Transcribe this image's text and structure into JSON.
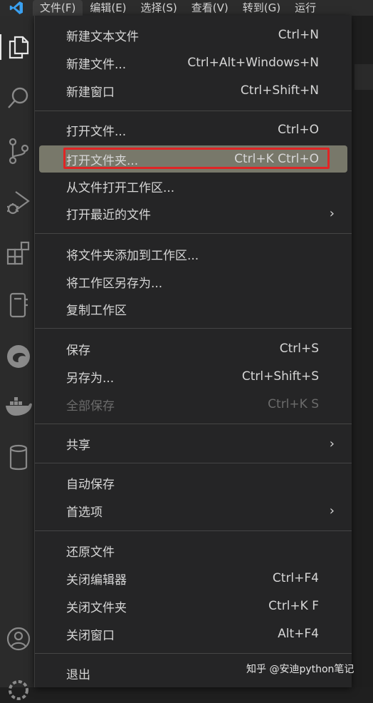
{
  "menubar": {
    "items": [
      "文件(F)",
      "编辑(E)",
      "选择(S)",
      "查看(V)",
      "转到(G)",
      "运行"
    ]
  },
  "activity_icons": [
    "explorer-icon",
    "search-icon",
    "source-control-icon",
    "run-debug-icon",
    "extensions-icon",
    "notebook-icon",
    "edge-icon",
    "docker-icon",
    "database-icon",
    "account-icon",
    "settings-icon"
  ],
  "file_menu": {
    "items": [
      {
        "label": "新建文本文件",
        "shortcut": "Ctrl+N"
      },
      {
        "label": "新建文件...",
        "shortcut": "Ctrl+Alt+Windows+N"
      },
      {
        "label": "新建窗口",
        "shortcut": "Ctrl+Shift+N"
      },
      {
        "label": "打开文件...",
        "shortcut": "Ctrl+O"
      },
      {
        "label": "打开文件夹...",
        "shortcut": "Ctrl+K Ctrl+O"
      },
      {
        "label": "从文件打开工作区...",
        "shortcut": ""
      },
      {
        "label": "打开最近的文件",
        "shortcut": ""
      },
      {
        "label": "将文件夹添加到工作区...",
        "shortcut": ""
      },
      {
        "label": "将工作区另存为...",
        "shortcut": ""
      },
      {
        "label": "复制工作区",
        "shortcut": ""
      },
      {
        "label": "保存",
        "shortcut": "Ctrl+S"
      },
      {
        "label": "另存为...",
        "shortcut": "Ctrl+Shift+S"
      },
      {
        "label": "全部保存",
        "shortcut": "Ctrl+K S"
      },
      {
        "label": "共享",
        "shortcut": ""
      },
      {
        "label": "自动保存",
        "shortcut": ""
      },
      {
        "label": "首选项",
        "shortcut": ""
      },
      {
        "label": "还原文件",
        "shortcut": ""
      },
      {
        "label": "关闭编辑器",
        "shortcut": "Ctrl+F4"
      },
      {
        "label": "关闭文件夹",
        "shortcut": "Ctrl+K F"
      },
      {
        "label": "关闭窗口",
        "shortcut": "Alt+F4"
      },
      {
        "label": "退出",
        "shortcut": ""
      }
    ]
  },
  "watermark": "知乎 @安迪python笔记",
  "colors": {
    "highlight_border": "#e02525",
    "hover_bg": "#78786a",
    "vscode_blue": "#3aa0f0"
  }
}
